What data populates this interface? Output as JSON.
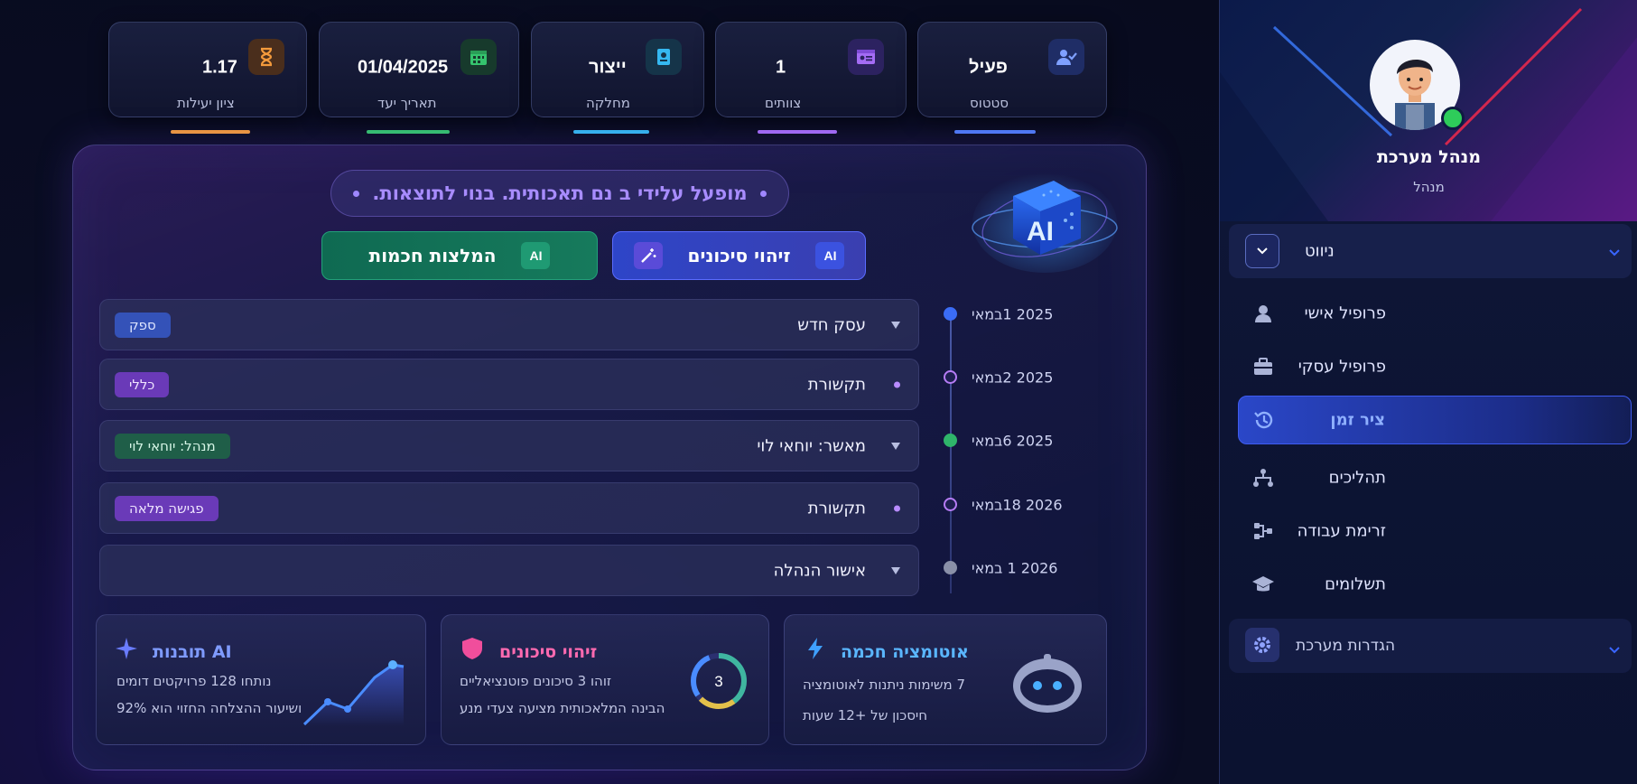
{
  "stats": [
    {
      "value": "1.17",
      "label": "ציון יעילות",
      "icon": "hourglass-icon",
      "color": "#f39a3c"
    },
    {
      "value": "01/04/2025",
      "label": "תאריך יעד",
      "icon": "calendar-icon",
      "color": "#35c46d"
    },
    {
      "value": "ייצור",
      "label": "מחלקה",
      "icon": "badge-icon",
      "color": "#35b8f0"
    },
    {
      "value": "1",
      "label": "צוותים",
      "icon": "id-card-icon",
      "color": "#a46cf5"
    },
    {
      "value": "פעיל",
      "label": "סטטוס",
      "icon": "user-check-icon",
      "color": "#4f7cf5"
    }
  ],
  "main": {
    "powered_text": "מופעל עלידי ב נם תאכותית. בנוי לתוצאות.",
    "ai_logo_text": "AI",
    "tab_risk": {
      "label": "זיהוי סיכונים",
      "badge": "AI"
    },
    "tab_smart": {
      "label": "המלצות חכמות",
      "badge": "AI"
    },
    "timeline": [
      {
        "title": "עסק חדש",
        "tag": "ספק",
        "date": "2025 1במאי",
        "marker": "triangle",
        "dot_color": "#3b6cf5"
      },
      {
        "title": "תקשורת",
        "tag": "כללי",
        "date": "2025 2במאי",
        "marker": "dot",
        "dot_color": "#b67cf5"
      },
      {
        "title": "מאשר: יוחאי לוי",
        "tag": "מנהל: יוחאי לוי",
        "date": "2025 6במאי",
        "marker": "triangle",
        "dot_color": "#2fb56a"
      },
      {
        "title": "תקשורת",
        "tag": "פגישה מלאה",
        "date": "2026 18במאי",
        "marker": "dot",
        "dot_color": "#b67cf5"
      },
      {
        "title": "אישור הנהלה",
        "tag": "",
        "date": "2026 1 במאי",
        "marker": "triangle",
        "dot_color": "#8a90a8"
      }
    ],
    "insights": {
      "ai": {
        "title": "תובנות AI",
        "line1": "נותחו 128 פרויקטים דומים",
        "line2": "ושיעור ההצלחה החזוי הוא 92%"
      },
      "risk": {
        "title": "זיהוי סיכונים",
        "line1": "זוהו 3 סיכונים פוטנציאליים",
        "line2": "הבינה המלאכותית מציעה צעדי מנע",
        "ring_value": "3"
      },
      "auto": {
        "title": "אוטומציה חכמה",
        "line1": "7 משימות ניתנות לאוטומציה",
        "line2": "חיסכון של +12 שעות"
      }
    }
  },
  "sidebar": {
    "user_name": "מנהל מערכת",
    "user_role": "מנהל",
    "nav_header": "ניווט",
    "items": [
      {
        "label": "פרופיל אישי",
        "icon": "user-icon"
      },
      {
        "label": "פרופיל עסקי",
        "icon": "briefcase-icon"
      },
      {
        "label": "ציר זמן",
        "icon": "history-icon"
      },
      {
        "label": "תהליכים",
        "icon": "hierarchy-icon"
      },
      {
        "label": "זרימת עבודה",
        "icon": "workflow-icon"
      },
      {
        "label": "תשלומים",
        "icon": "graduation-cap-icon"
      }
    ],
    "settings_label": "הגדרות מערכת"
  }
}
